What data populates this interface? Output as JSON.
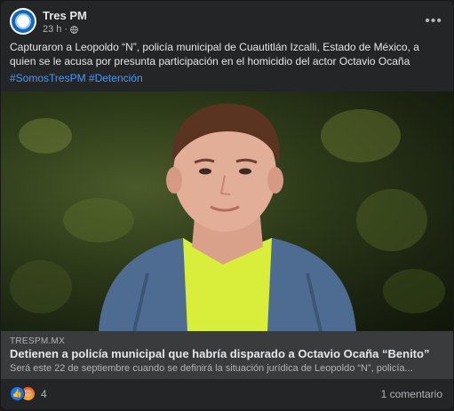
{
  "post": {
    "page_name": "Tres PM",
    "time": "23 h",
    "caption": "Capturaron a Leopoldo “N”, policía municipal de Cuautitlán Izcalli, Estado de México, a quien se le acusa por presunta participación en el homicidio del actor Octavio Ocaña",
    "hashtags": [
      "#SomosTresPM",
      "#Detención"
    ]
  },
  "link_preview": {
    "domain": "TRESPM.MX",
    "title": "Detienen a policía municipal que habría disparado a Octavio Ocaña “Benito”",
    "description": "Será este 22 de septiembre cuando se definirá la situación jurídica de Leopoldo “N”, policía..."
  },
  "footer": {
    "reaction_count": "4",
    "comments_label": "1 comentario"
  },
  "colors": {
    "background": "#242526",
    "link_box": "#3a3b3c",
    "hashtag": "#4599ff",
    "like": "#1b74e4"
  }
}
